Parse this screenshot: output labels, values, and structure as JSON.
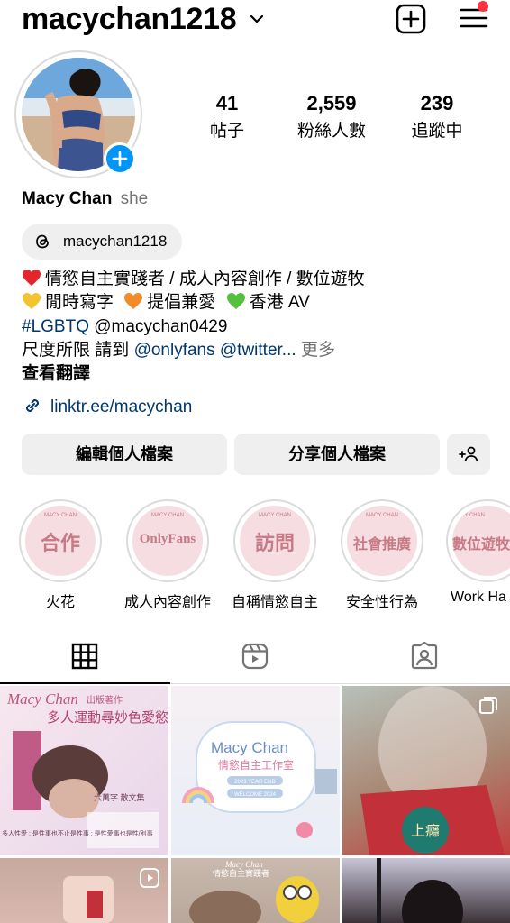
{
  "header": {
    "username": "macychan1218"
  },
  "stats": [
    {
      "value": "41",
      "label": "帖子"
    },
    {
      "value": "2,559",
      "label": "粉絲人數"
    },
    {
      "value": "239",
      "label": "追蹤中"
    }
  ],
  "profile": {
    "name": "Macy Chan",
    "pronoun": "she",
    "threads_handle": "macychan1218",
    "bio_line1": "情慾自主實踐者 / 成人內容創作 / 數位遊牧",
    "bio_line2_a": "閒時寫字",
    "bio_line2_b": "提倡兼愛",
    "bio_line2_c": "香港 AV",
    "bio_line3_hashtag": "#LGBTQ",
    "bio_line3_mention": "@macychan0429",
    "bio_line4_prefix": "尺度所限 請到 ",
    "bio_line4_links": "@onlyfans @twitter...",
    "bio_more": "更多",
    "translate": "查看翻譯",
    "link": "linktr.ee/macychan"
  },
  "buttons": {
    "edit": "編輯個人檔案",
    "share": "分享個人檔案"
  },
  "highlights": [
    {
      "cover_text": "合作",
      "label": "火花"
    },
    {
      "cover_text": "OnlyFans",
      "label": "成人內容創作"
    },
    {
      "cover_text": "訪問",
      "label": "自稱情慾自主"
    },
    {
      "cover_text": "社會推廣",
      "label": "安全性行為"
    },
    {
      "cover_text": "數位遊牧",
      "label": "Work Ha"
    }
  ],
  "highlight_badge": "MACY CHAN",
  "posts": {
    "p1_title": "Macy Chan",
    "p1_sub": "出版著作",
    "p1_heading": "多人運動尋妙色愛慾",
    "p1_body": "六萬字 散文集",
    "p1_footer": "多人性愛 : 是性事也不止是性事 ; 是性愛事也是性/別事",
    "p2_title": "Macy Chan",
    "p2_sub": "情慾自主工作室",
    "p2_btn1": "2023 YEAR END",
    "p2_btn2": "WELCOME 2024",
    "p3_badge": "上癮",
    "p5_title": "Macy Chan",
    "p5_sub": "情慾自主實踐者"
  },
  "colors": {
    "accent": "#0095f6",
    "link": "#00376b",
    "notification": "#ff3040",
    "button_bg": "#efefef",
    "highlight_pink": "#f6dde2"
  }
}
